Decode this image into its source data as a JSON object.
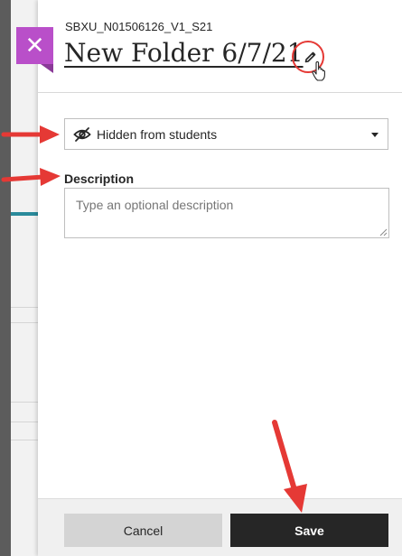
{
  "header": {
    "course_id": "SBXU_N01506126_V1_S21",
    "title": "New Folder 6/7/21"
  },
  "visibility": {
    "selected": "Hidden from students"
  },
  "description": {
    "label": "Description",
    "placeholder": "Type an optional description",
    "value": ""
  },
  "footer": {
    "cancel_label": "Cancel",
    "save_label": "Save"
  },
  "colors": {
    "close_accent": "#b94fc9",
    "annotation_red": "#e53935",
    "save_bg": "#262626",
    "cancel_bg": "#d4d4d4"
  },
  "icons": {
    "close": "close-icon",
    "edit": "pencil-icon",
    "visibility": "eye-slash-icon",
    "dropdown": "chevron-down-icon"
  }
}
